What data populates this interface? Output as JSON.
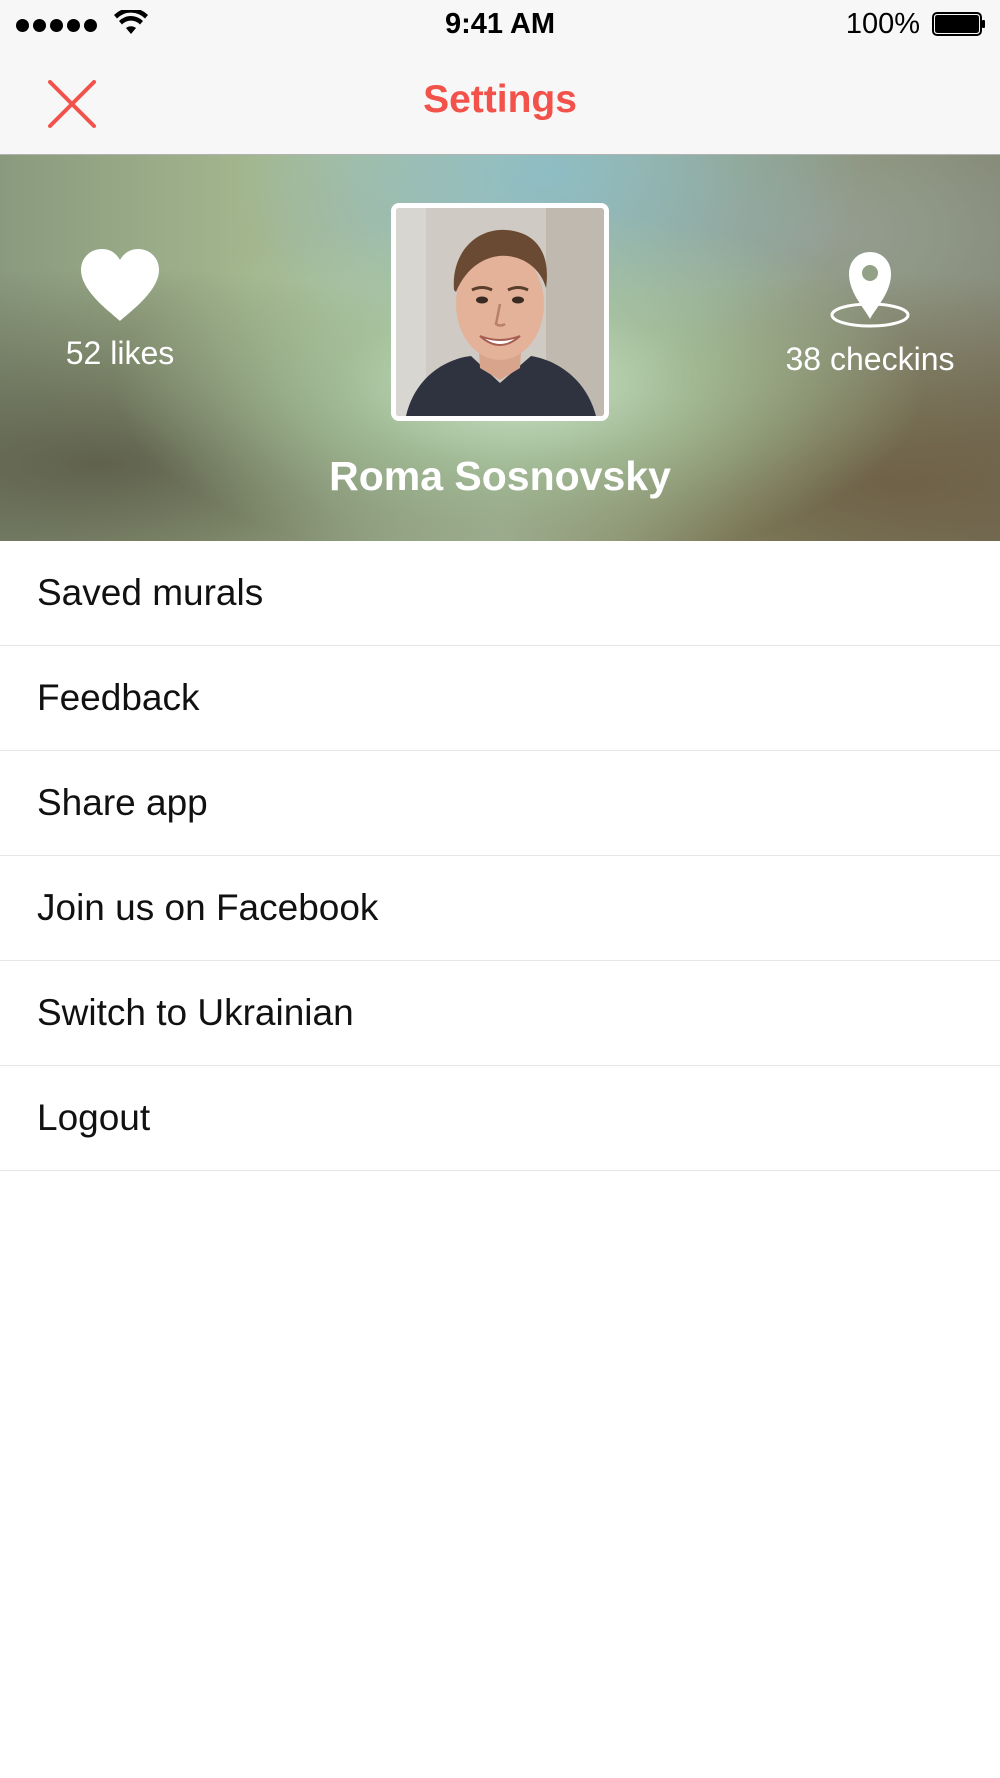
{
  "status_bar": {
    "time": "9:41 AM",
    "battery": "100%"
  },
  "nav": {
    "title": "Settings",
    "close_icon": "close-icon"
  },
  "profile": {
    "name": "Roma Sosnovsky",
    "likes_label": "52 likes",
    "checkins_label": "38 checkins",
    "likes_icon": "heart-icon",
    "checkins_icon": "map-pin-icon"
  },
  "menu": {
    "items": [
      {
        "label": "Saved murals"
      },
      {
        "label": "Feedback"
      },
      {
        "label": "Share app"
      },
      {
        "label": "Join us on Facebook"
      },
      {
        "label": "Switch to Ukrainian"
      },
      {
        "label": "Logout"
      }
    ]
  },
  "colors": {
    "accent": "#f2524a",
    "nav_background": "#f7f7f7"
  }
}
